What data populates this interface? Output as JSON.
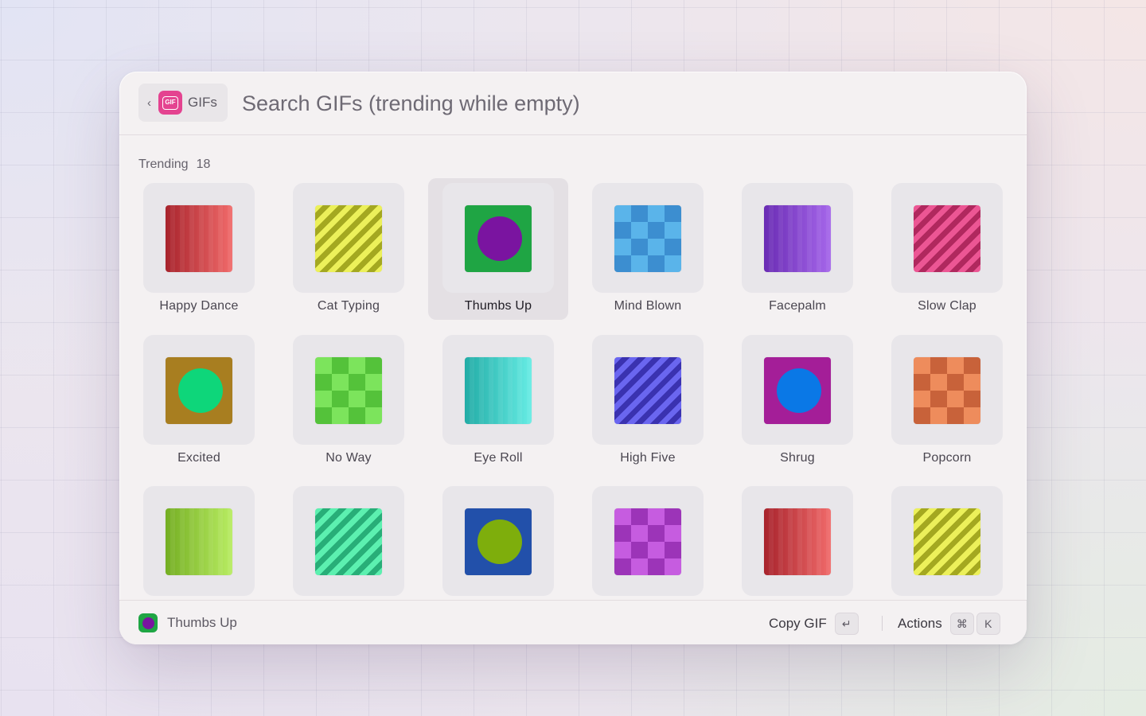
{
  "header": {
    "back_chip": {
      "label": "GIFs",
      "icon": "gif-logo",
      "icon_text": "GIF",
      "chevron": "‹",
      "color": "#e44390"
    },
    "search": {
      "placeholder": "Search GIFs (trending while empty)",
      "value": ""
    }
  },
  "section": {
    "title": "Trending",
    "count": "18"
  },
  "selected_index": 2,
  "items": [
    {
      "label": "Happy Dance",
      "pattern": "stripes-v",
      "colors": [
        "#a8232c",
        "#f06a6a"
      ]
    },
    {
      "label": "Cat Typing",
      "pattern": "stripes-diag",
      "colors": [
        "#ecf05a",
        "#a4a820"
      ]
    },
    {
      "label": "Thumbs Up",
      "pattern": "dot",
      "colors": [
        "#1fa544",
        "#7a14a0"
      ]
    },
    {
      "label": "Mind Blown",
      "pattern": "checker",
      "colors": [
        "#5ab4ea",
        "#3c8ed0"
      ]
    },
    {
      "label": "Facepalm",
      "pattern": "stripes-v",
      "colors": [
        "#6a2cb4",
        "#a566ea"
      ]
    },
    {
      "label": "Slow Clap",
      "pattern": "stripes-diag",
      "colors": [
        "#ec5694",
        "#b0285e"
      ]
    },
    {
      "label": "Excited",
      "pattern": "dot",
      "colors": [
        "#a87e20",
        "#0ed67a"
      ]
    },
    {
      "label": "No Way",
      "pattern": "checker",
      "colors": [
        "#7ce45c",
        "#54c23a"
      ]
    },
    {
      "label": "Eye Roll",
      "pattern": "stripes-v",
      "colors": [
        "#22aca6",
        "#66ece4"
      ]
    },
    {
      "label": "High Five",
      "pattern": "stripes-diag",
      "colors": [
        "#6a66f0",
        "#3a32b0"
      ]
    },
    {
      "label": "Shrug",
      "pattern": "dot",
      "colors": [
        "#a41e98",
        "#0a78e6"
      ]
    },
    {
      "label": "Popcorn",
      "pattern": "checker",
      "colors": [
        "#ee8c5c",
        "#c8623a"
      ]
    },
    {
      "label": "",
      "pattern": "stripes-v",
      "colors": [
        "#74ae22",
        "#b8ec62"
      ]
    },
    {
      "label": "",
      "pattern": "stripes-diag",
      "colors": [
        "#5cf0b0",
        "#28ae78"
      ]
    },
    {
      "label": "",
      "pattern": "dot",
      "colors": [
        "#2250aa",
        "#7eae0c"
      ]
    },
    {
      "label": "",
      "pattern": "checker",
      "colors": [
        "#c65ce0",
        "#9c34b8"
      ]
    },
    {
      "label": "",
      "pattern": "stripes-v",
      "colors": [
        "#a8232c",
        "#f06a6a"
      ]
    },
    {
      "label": "",
      "pattern": "stripes-diag",
      "colors": [
        "#ecf05a",
        "#a4a820"
      ]
    }
  ],
  "footer": {
    "selected_title": "Thumbs Up",
    "selected_icon_colors": [
      "#1fa544",
      "#7a14a0"
    ],
    "primary_action": {
      "label": "Copy GIF",
      "key": "↵"
    },
    "secondary_action": {
      "label": "Actions",
      "keys": [
        "⌘",
        "K"
      ]
    }
  }
}
